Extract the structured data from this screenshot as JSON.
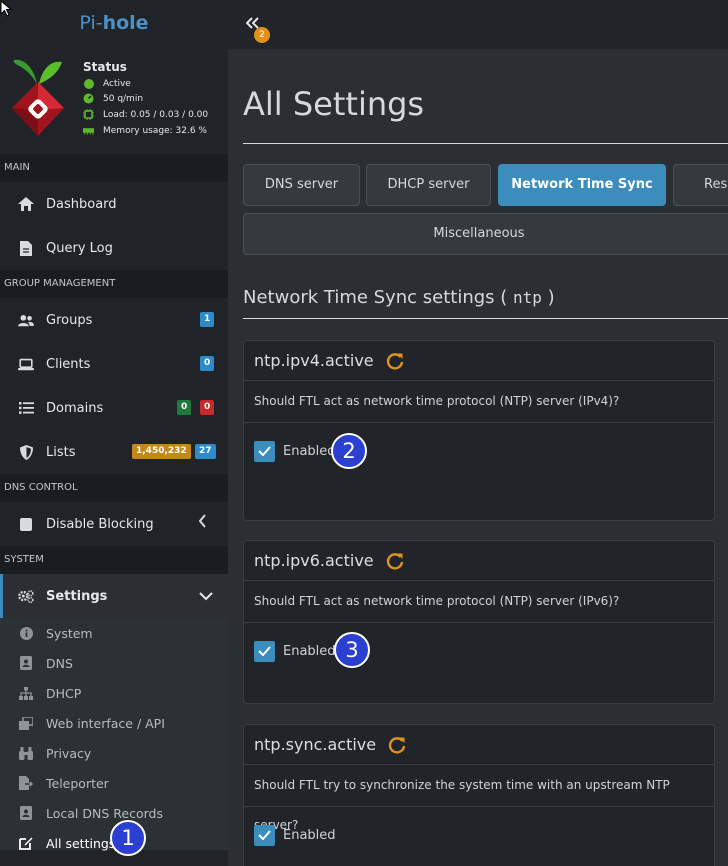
{
  "brand": {
    "prefix": "Pi-",
    "name": "hole"
  },
  "status": {
    "title": "Status",
    "active": "Active",
    "rate": "50 q/min",
    "load": "Load: 0.05 / 0.03 / 0.00",
    "memory": "Memory usage: 32.6 %"
  },
  "sidebar": {
    "main_header": "MAIN",
    "dashboard": "Dashboard",
    "query_log": "Query Log",
    "group_header": "GROUP MANAGEMENT",
    "groups": "Groups",
    "groups_count": "1",
    "clients": "Clients",
    "clients_count": "0",
    "domains": "Domains",
    "domains_allow": "0",
    "domains_deny": "0",
    "lists": "Lists",
    "lists_domains": "1,450,232",
    "lists_count": "27",
    "dns_header": "DNS CONTROL",
    "disable_blocking": "Disable Blocking",
    "system_header": "SYSTEM",
    "settings": "Settings",
    "sub": {
      "system": "System",
      "dns": "DNS",
      "dhcp": "DHCP",
      "web": "Web interface / API",
      "privacy": "Privacy",
      "teleporter": "Teleporter",
      "local_dns": "Local DNS Records",
      "all": "All settings"
    }
  },
  "topbar": {
    "notifications": "2"
  },
  "main": {
    "title": "All Settings",
    "tabs": {
      "dns": "DNS server",
      "dhcp": "DHCP server",
      "ntp": "Network Time Sync",
      "resolver": "Resolver",
      "misc": "Miscellaneous"
    },
    "section_title_prefix": "Network Time Sync settings (",
    "section_code": "ntp",
    "section_title_suffix": ")",
    "cards": [
      {
        "key": "ntp.ipv4.active",
        "desc": "Should FTL act as network time protocol (NTP) server (IPv4)?",
        "check_label": "Enabled"
      },
      {
        "key": "ntp.ipv6.active",
        "desc": "Should FTL act as network time protocol (NTP) server (IPv6)?",
        "check_label": "Enabled"
      },
      {
        "key": "ntp.sync.active",
        "desc": "Should FTL try to synchronize the system time with an upstream NTP server?",
        "check_label": "Enabled"
      }
    ]
  },
  "annotations": {
    "one": "1",
    "two": "2",
    "three": "3"
  }
}
